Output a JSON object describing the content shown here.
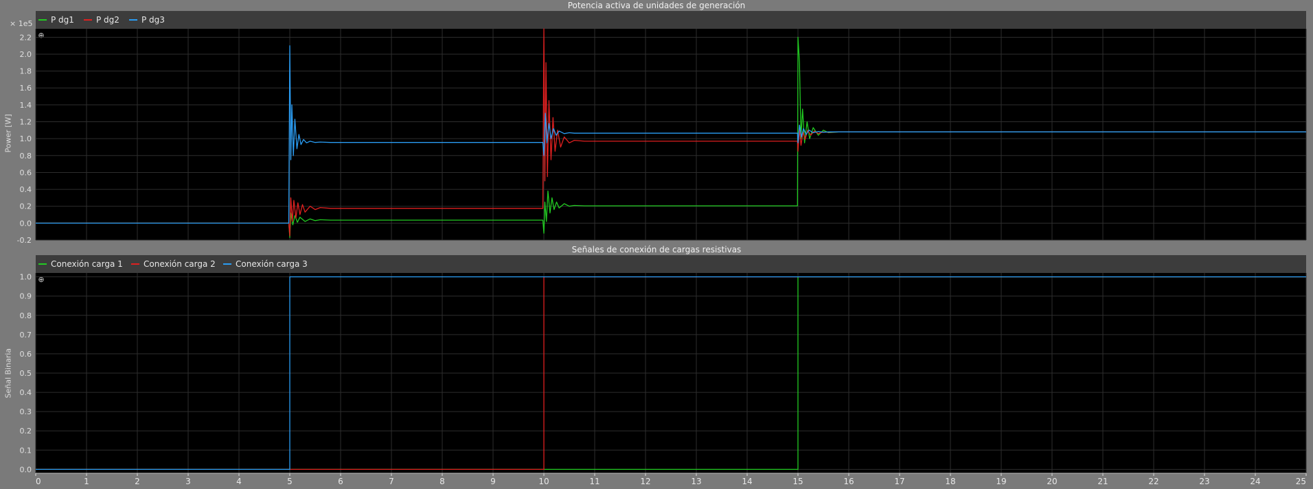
{
  "chart_data": [
    {
      "type": "line",
      "title": "Potencia activa de unidades de generación",
      "ylabel": "Power [W]",
      "scale_label": "× 1e5",
      "xlim": [
        0,
        25
      ],
      "ylim": [
        -0.2,
        2.3
      ],
      "y_ticks": [
        -0.2,
        0.0,
        0.2,
        0.4,
        0.6,
        0.8,
        1.0,
        1.2,
        1.4,
        1.6,
        1.8,
        2.0,
        2.2
      ],
      "y_tick_labels": [
        "-0.2",
        "0.0",
        "0.2",
        "0.4",
        "0.6",
        "0.8",
        "1.0",
        "1.2",
        "1.4",
        "1.6",
        "1.8",
        "2.0",
        "2.2"
      ],
      "grid": true,
      "legend_position": "top-left",
      "series": [
        {
          "name": "P dg1",
          "color": "#22cc22",
          "x": [
            0,
            4.98,
            5.0,
            5.02,
            5.06,
            5.1,
            5.15,
            5.2,
            5.3,
            5.4,
            5.5,
            5.6,
            5.8,
            6.0,
            9.98,
            10.0,
            10.02,
            10.05,
            10.08,
            10.12,
            10.16,
            10.2,
            10.25,
            10.3,
            10.4,
            10.5,
            10.6,
            10.8,
            11.0,
            14.99,
            15.0,
            15.03,
            15.06,
            15.09,
            15.13,
            15.18,
            15.23,
            15.3,
            15.4,
            15.5,
            15.6,
            15.8,
            16.0,
            25
          ],
          "y": [
            0,
            0,
            -0.17,
            0.12,
            -0.02,
            0.09,
            0.01,
            0.07,
            0.02,
            0.05,
            0.03,
            0.04,
            0.035,
            0.035,
            0.035,
            -0.12,
            0.25,
            0.02,
            0.38,
            0.12,
            0.3,
            0.16,
            0.25,
            0.18,
            0.23,
            0.2,
            0.21,
            0.205,
            0.205,
            0.205,
            2.2,
            1.9,
            1.0,
            1.35,
            0.95,
            1.2,
            1.0,
            1.13,
            1.04,
            1.1,
            1.07,
            1.08,
            1.08,
            1.08
          ]
        },
        {
          "name": "P dg2",
          "color": "#e02020",
          "x": [
            0,
            4.98,
            5.0,
            5.02,
            5.05,
            5.08,
            5.12,
            5.16,
            5.2,
            5.25,
            5.3,
            5.4,
            5.5,
            5.6,
            5.8,
            6.0,
            9.98,
            10.0,
            10.02,
            10.04,
            10.07,
            10.1,
            10.14,
            10.18,
            10.22,
            10.27,
            10.33,
            10.4,
            10.5,
            10.6,
            10.8,
            11.0,
            14.99,
            15.0,
            15.03,
            15.06,
            15.1,
            15.14,
            15.19,
            15.25,
            15.32,
            15.4,
            15.5,
            15.6,
            15.8,
            16.0,
            25
          ],
          "y": [
            0,
            0,
            -0.15,
            0.3,
            0.02,
            0.27,
            0.06,
            0.24,
            0.1,
            0.22,
            0.13,
            0.2,
            0.16,
            0.185,
            0.175,
            0.175,
            0.175,
            2.3,
            0.5,
            1.9,
            0.55,
            1.45,
            0.75,
            1.25,
            0.85,
            1.1,
            0.9,
            1.02,
            0.95,
            0.98,
            0.97,
            0.97,
            0.97,
            0.85,
            1.12,
            0.92,
            1.08,
            0.99,
            1.1,
            1.04,
            1.09,
            1.06,
            1.08,
            1.075,
            1.08,
            1.08,
            1.08
          ]
        },
        {
          "name": "P dg3",
          "color": "#2a9df4",
          "x": [
            0,
            4.98,
            5.0,
            5.02,
            5.04,
            5.07,
            5.1,
            5.14,
            5.18,
            5.22,
            5.27,
            5.33,
            5.4,
            5.5,
            5.6,
            5.8,
            6.0,
            9.98,
            10.0,
            10.03,
            10.06,
            10.1,
            10.14,
            10.19,
            10.24,
            10.3,
            10.4,
            10.5,
            10.6,
            10.8,
            11.0,
            14.99,
            15.0,
            15.03,
            15.07,
            15.11,
            15.16,
            15.22,
            15.3,
            15.4,
            15.5,
            15.6,
            15.8,
            16.0,
            25
          ],
          "y": [
            0,
            0,
            2.1,
            0.75,
            1.4,
            0.8,
            1.23,
            0.88,
            1.05,
            0.93,
            0.99,
            0.95,
            0.97,
            0.955,
            0.96,
            0.955,
            0.955,
            0.955,
            0.8,
            1.3,
            0.95,
            1.18,
            1.0,
            1.12,
            1.04,
            1.09,
            1.06,
            1.07,
            1.065,
            1.065,
            1.065,
            1.065,
            0.95,
            1.16,
            1.02,
            1.12,
            1.05,
            1.1,
            1.07,
            1.085,
            1.075,
            1.08,
            1.08,
            1.08,
            1.08
          ]
        }
      ]
    },
    {
      "type": "line",
      "title": "Señales de conexión de cargas resistivas",
      "ylabel": "Señal Binaria",
      "xlim": [
        0,
        25
      ],
      "ylim": [
        -0.02,
        1.02
      ],
      "y_ticks": [
        0.0,
        0.1,
        0.2,
        0.3,
        0.4,
        0.5,
        0.6,
        0.7,
        0.8,
        0.9,
        1.0
      ],
      "y_tick_labels": [
        "0.0",
        "0.1",
        "0.2",
        "0.3",
        "0.4",
        "0.5",
        "0.6",
        "0.7",
        "0.8",
        "0.9",
        "1.0"
      ],
      "x_ticks": [
        0,
        1,
        2,
        3,
        4,
        5,
        6,
        7,
        8,
        9,
        10,
        11,
        12,
        13,
        14,
        15,
        16,
        17,
        18,
        19,
        20,
        21,
        22,
        23,
        24,
        25
      ],
      "x_tick_labels": [
        "0",
        "1",
        "2",
        "3",
        "4",
        "5",
        "6",
        "7",
        "8",
        "9",
        "10",
        "11",
        "12",
        "13",
        "14",
        "15",
        "16",
        "17",
        "18",
        "19",
        "20",
        "21",
        "22",
        "23",
        "24",
        "25"
      ],
      "grid": true,
      "legend_position": "top-left",
      "series": [
        {
          "name": "Conexión carga 1",
          "color": "#22cc22",
          "x": [
            0,
            15,
            15,
            25
          ],
          "y": [
            0,
            0,
            1,
            1
          ]
        },
        {
          "name": "Conexión carga 2",
          "color": "#e02020",
          "x": [
            0,
            10,
            10,
            25
          ],
          "y": [
            0,
            0,
            1,
            1
          ]
        },
        {
          "name": "Conexión carga 3",
          "color": "#2a9df4",
          "x": [
            0,
            5,
            5,
            25
          ],
          "y": [
            0,
            0,
            1,
            1
          ]
        }
      ]
    }
  ]
}
